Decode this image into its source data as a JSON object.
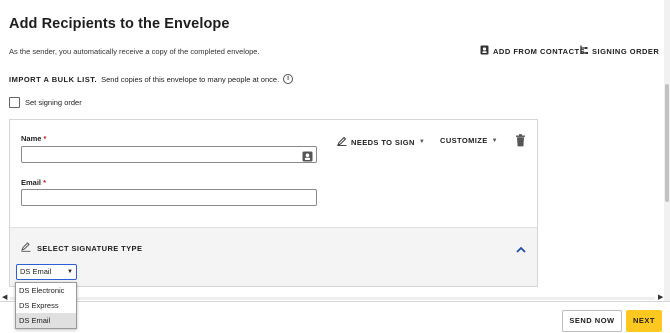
{
  "page": {
    "title": "Add Recipients to the Envelope",
    "subtitle": "As the sender, you automatically receive a copy of the completed envelope."
  },
  "header_actions": {
    "add_from_contacts": "ADD FROM CONTACTS",
    "signing_order": "SIGNING ORDER"
  },
  "bulk": {
    "link": "IMPORT A BULK LIST.",
    "text": "Send copies of this envelope to many people at once."
  },
  "set_signing_order": "Set signing order",
  "recipient": {
    "name_label": "Name",
    "email_label": "Email",
    "required_mark": "*",
    "name_value": "",
    "email_value": "",
    "role": "NEEDS TO SIGN",
    "customize": "CUSTOMIZE"
  },
  "signature": {
    "heading": "SELECT SIGNATURE TYPE",
    "selected": "DS Email",
    "options": [
      "DS Electronic",
      "DS Express",
      "DS Email"
    ]
  },
  "footer": {
    "send_now": "SEND NOW",
    "next": "NEXT"
  },
  "colors": {
    "accent_yellow": "#ffc820",
    "required_red": "#c8102e",
    "focus_blue": "#2b5fd9"
  }
}
